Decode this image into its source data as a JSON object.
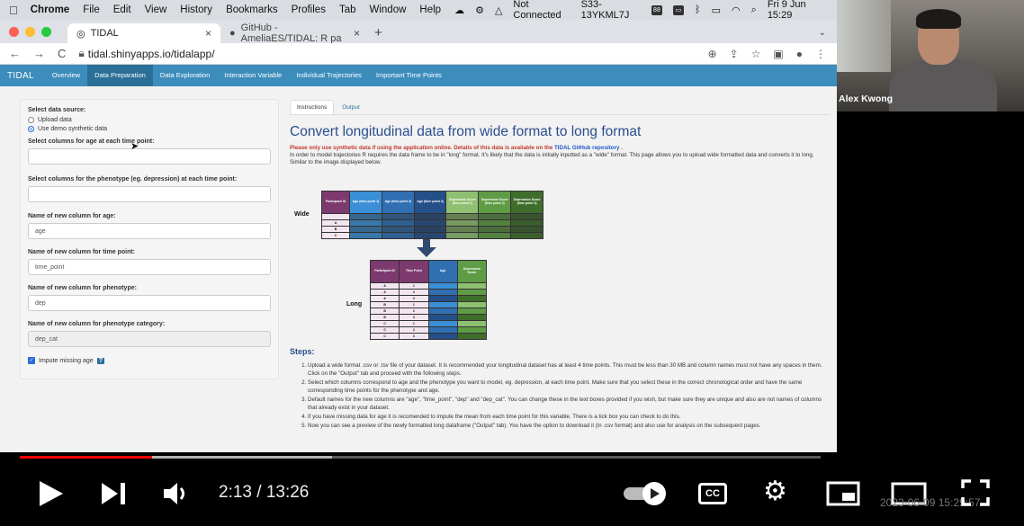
{
  "menubar": {
    "app": "Chrome",
    "items": [
      "File",
      "Edit",
      "View",
      "History",
      "Bookmarks",
      "Profiles",
      "Tab",
      "Window",
      "Help"
    ],
    "status": "Not Connected",
    "host": "S33-13YKML7J",
    "clock": "Fri 9 Jun 15:29"
  },
  "browser": {
    "tabs": [
      {
        "label": "TIDAL",
        "close": "×"
      },
      {
        "label": "GitHub - AmeliaES/TIDAL: R pa",
        "close": "×"
      }
    ],
    "new_tab": "+",
    "url": "tidal.shinyapps.io/tidalapp/"
  },
  "app": {
    "brand": "TIDAL",
    "nav": [
      "Overview",
      "Data Preparation",
      "Data Exploration",
      "Interaction Variable",
      "Individual Trajectories",
      "Important Time Points"
    ],
    "active_nav": "Data Preparation"
  },
  "sidebar": {
    "source_label": "Select data source:",
    "source_options": [
      "Upload data",
      "Use demo synthetic data"
    ],
    "age_cols_label": "Select columns for age at each time point:",
    "pheno_cols_label": "Select columns for the phenotype (eg. depression) at each time point:",
    "age_name_label": "Name of new column for age:",
    "age_name_value": "age",
    "time_name_label": "Name of new column for time point:",
    "time_name_value": "time_point",
    "pheno_name_label": "Name of new column for phenotype:",
    "pheno_name_value": "dep",
    "cat_name_label": "Name of new column for phenotype category:",
    "cat_name_value": "dep_cat",
    "impute_label": "Impute missing age",
    "help": "?"
  },
  "main": {
    "tabs": [
      "Instructions",
      "Output"
    ],
    "title": "Convert longitudinal data from wide format to long format",
    "warning": "Please only use synthetic data if using the application online. Details of this data is available on the",
    "warning_link": "TIDAL GitHub repository",
    "warning_end": ".",
    "intro": "In order to model trajectories R requires the data frame to be in \"long\" format. It's likely that the data is initially inputted as a \"wide\" format. This page allows you to upload wide formatted data and converts it to long. Similar to the image displayed below.",
    "wide_label": "Wide",
    "long_label": "Long",
    "wide_headers": [
      "Participant ID",
      "Age (time point 1)",
      "Age (time point 2)",
      "Age (time point 3)",
      "Depression Score (time point 1)",
      "Depression Score (time point 2)",
      "Depression Score (time point 3)"
    ],
    "wide_ids": [
      "A",
      "B",
      "C"
    ],
    "long_headers": [
      "Participant ID",
      "Time Point",
      "Age",
      "Depression Score"
    ],
    "long_ids": [
      "A",
      "A",
      "A",
      "B",
      "B",
      "B",
      "C",
      "C",
      "C"
    ],
    "long_times": [
      "1",
      "2",
      "3",
      "1",
      "2",
      "3",
      "1",
      "2",
      "3"
    ],
    "steps_title": "Steps:",
    "steps": [
      "Upload a wide format .csv or .tsv file of your dataset. It is recommended your longitudinal dataset has at least 4 time points. This must be less than 30 MB and column names must not have any spaces in them. Click on the \"Output\" tab and proceed with the following steps.",
      "Select which columns correspond to age and the phenotype you want to model, eg. depression, at each time point. Make sure that you select these in the correct chronological order and have the same corresponding time points for the phenotype and age.",
      "Default names for the new columns are \"age\", \"time_point\", \"dep\" and \"dep_cat\". You can change these in the text boxes provided if you wish, but make sure they are unique and also are not names of columns that already exist in your dataset.",
      "If you have missing data for age it is recomended to impute the mean from each time point for this variable. There is a tick box you can check to do this.",
      "Now you can see a preview of the newly formatted long dataframe (\"Output\" tab). You have the option to download it (in .csv format) and also use for analysis on the subsequent pages."
    ]
  },
  "webcam": {
    "name": "Alex Kwong"
  },
  "player": {
    "time": "2:13 / 13:26",
    "played_fraction": 0.165,
    "buffered_fraction": 0.39,
    "timestamp": "2023-06-09 15:29:57",
    "cc": "CC"
  },
  "colors": {
    "nav": "#3c8dbc",
    "age1": "#3b8fd6",
    "age2": "#2f6fb2",
    "age3": "#244f88",
    "dep1": "#8fbf70",
    "dep2": "#5f9c45",
    "dep3": "#3f6e2c",
    "id_header": "#7d3a6e"
  }
}
